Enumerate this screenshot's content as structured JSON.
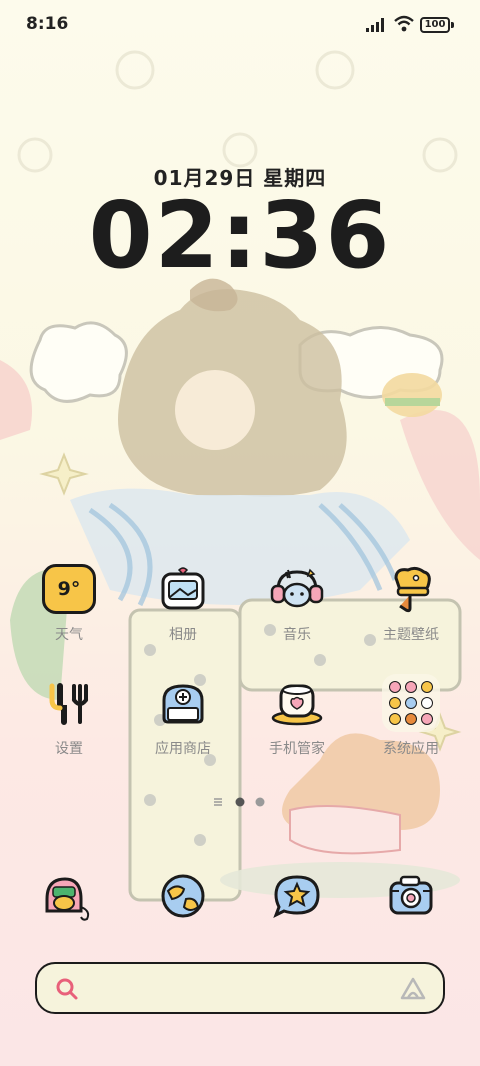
{
  "status_bar": {
    "time": "8:16",
    "battery": "100"
  },
  "clock_widget": {
    "date": "01月29日 星期四",
    "time": "02:36"
  },
  "apps_row1": [
    {
      "label": "天气",
      "icon": "weather-icon",
      "icon_text": "9°"
    },
    {
      "label": "相册",
      "icon": "gallery-icon"
    },
    {
      "label": "音乐",
      "icon": "music-icon"
    },
    {
      "label": "主题壁纸",
      "icon": "themes-icon"
    }
  ],
  "apps_row2": [
    {
      "label": "设置",
      "icon": "settings-icon"
    },
    {
      "label": "应用商店",
      "icon": "app-store-icon"
    },
    {
      "label": "手机管家",
      "icon": "phone-manager-icon"
    },
    {
      "label": "系统应用",
      "icon": "system-apps-folder-icon"
    }
  ],
  "dock": [
    {
      "icon": "phone-icon"
    },
    {
      "icon": "browser-icon"
    },
    {
      "icon": "messages-icon"
    },
    {
      "icon": "camera-icon"
    }
  ],
  "search": {
    "placeholder": ""
  },
  "colors": {
    "accent_pink": "#e8607a",
    "outline": "#1b1b1b",
    "yellow": "#f7c548",
    "blue": "#a8cdf0"
  }
}
